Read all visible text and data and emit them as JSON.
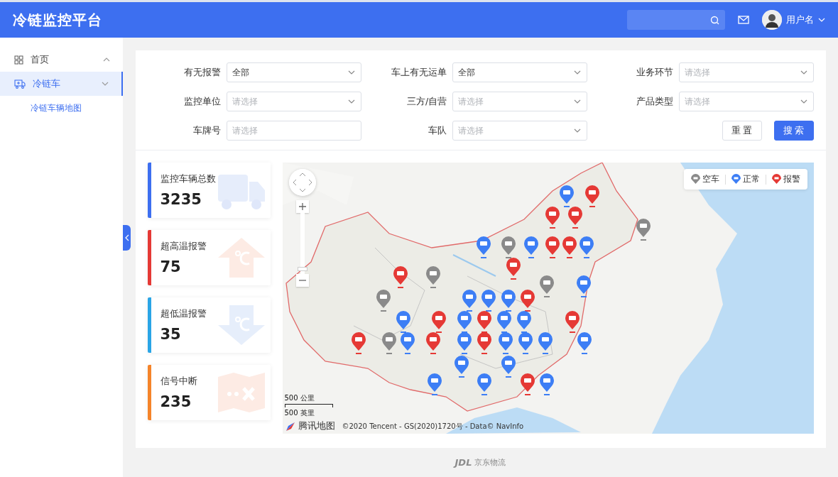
{
  "header": {
    "title": "冷链监控平台",
    "user": {
      "name": "用户名"
    }
  },
  "sidebar": {
    "items": [
      {
        "label": "首页",
        "expanded": true,
        "selected": false
      },
      {
        "label": "冷链车",
        "expanded": false,
        "selected": true,
        "children": [
          {
            "label": "冷链车辆地图",
            "selected": true
          }
        ]
      }
    ]
  },
  "filters": [
    {
      "label": "有无报警",
      "kind": "select",
      "value": "全部"
    },
    {
      "label": "车上有无运单",
      "kind": "select",
      "value": "全部"
    },
    {
      "label": "业务环节",
      "kind": "select",
      "placeholder": "请选择"
    },
    {
      "label": "监控单位",
      "kind": "select",
      "placeholder": "请选择"
    },
    {
      "label": "三方/自营",
      "kind": "select",
      "placeholder": "请选择"
    },
    {
      "label": "产品类型",
      "kind": "select",
      "placeholder": "请选择"
    },
    {
      "label": "车牌号",
      "kind": "input",
      "placeholder": "请选择"
    },
    {
      "label": "车队",
      "kind": "select",
      "placeholder": "请选择"
    }
  ],
  "buttons": [
    {
      "label": "重 置",
      "kind": "secondary"
    },
    {
      "label": "搜 索",
      "kind": "primary"
    }
  ],
  "stats": [
    {
      "label": "监控车辆总数",
      "value": "3235",
      "kind": "total",
      "color": "#3d6ff0"
    },
    {
      "label": "超高温报警",
      "value": "75",
      "kind": "high",
      "color": "#e53935"
    },
    {
      "label": "超低温报警",
      "value": "35",
      "kind": "low",
      "color": "#2aa5e6"
    },
    {
      "label": "信号中断",
      "value": "235",
      "kind": "signal",
      "color": "#f5842a"
    }
  ],
  "map": {
    "kind": "picture",
    "zoom": {
      "level": 0.05
    },
    "legend": [
      {
        "label": "空车",
        "color": "#8a8a8a"
      },
      {
        "label": "正常",
        "color": "#3d7ef5"
      },
      {
        "label": "报警",
        "color": "#e53935"
      }
    ],
    "scale": [
      "500 公里",
      "500 英里"
    ],
    "brand": "腾讯地图",
    "attribution": "©2020 Tencent - GS(2020)1720号 - Data© NavInfo"
  },
  "footer": {
    "logo": "JDL",
    "name": "京东物流"
  }
}
